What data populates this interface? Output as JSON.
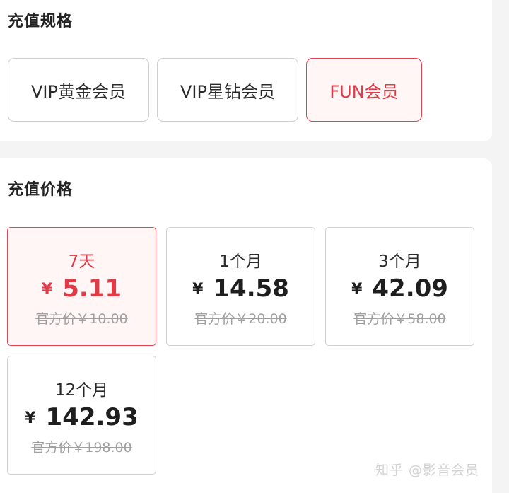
{
  "spec": {
    "title": "充值规格",
    "options": [
      {
        "label": "VIP黄金会员",
        "selected": false
      },
      {
        "label": "VIP星钻会员",
        "selected": false
      },
      {
        "label": "FUN会员",
        "selected": true
      }
    ]
  },
  "price": {
    "title": "充值价格",
    "currency_symbol": "¥",
    "options": [
      {
        "period": "7天",
        "amount": "5.11",
        "original": "官方价￥10.00",
        "selected": true
      },
      {
        "period": "1个月",
        "amount": "14.58",
        "original": "官方价￥20.00",
        "selected": false
      },
      {
        "period": "3个月",
        "amount": "42.09",
        "original": "官方价￥58.00",
        "selected": false
      },
      {
        "period": "12个月",
        "amount": "142.93",
        "original": "官方价￥198.00",
        "selected": false
      }
    ]
  },
  "watermark": "知乎 @影音会员",
  "colors": {
    "accent": "#e23a47",
    "accent_bg": "#fff6f5",
    "border": "#cfcfcf",
    "muted": "#a0a0a0"
  }
}
